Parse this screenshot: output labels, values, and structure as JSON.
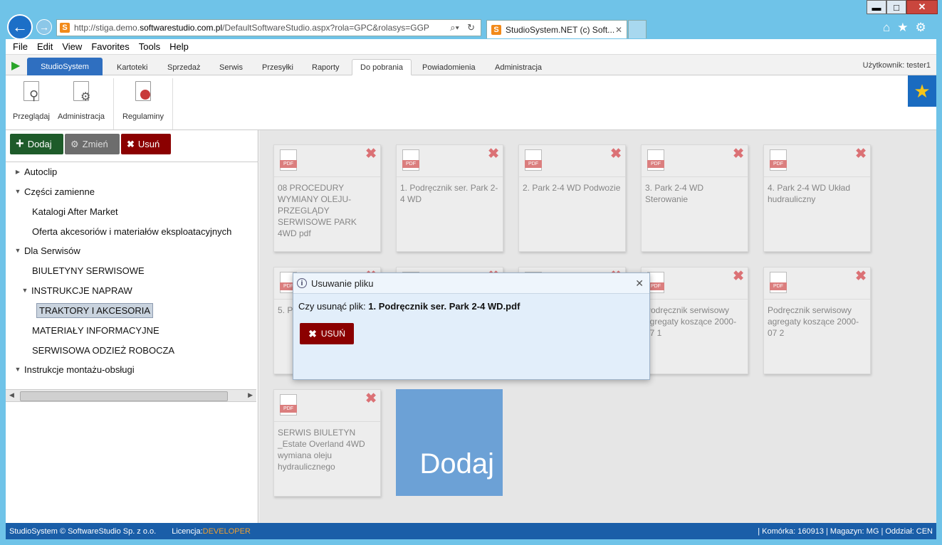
{
  "browser": {
    "url_prefix": "http://stiga.demo.",
    "url_domain": "softwarestudio.com.pl",
    "url_path": "/DefaultSoftwareStudio.aspx?rola=GPC&rolasys=GGP",
    "tab_title": "StudioSystem.NET (c) Soft...",
    "window_minimize": "▬",
    "window_maximize": "□",
    "window_close": "✕",
    "menu": [
      "File",
      "Edit",
      "View",
      "Favorites",
      "Tools",
      "Help"
    ]
  },
  "app": {
    "brand": "StudioSystem",
    "tabs": [
      "Kartoteki",
      "Sprzedaż",
      "Serwis",
      "Przesyłki",
      "Raporty",
      "Do pobrania",
      "Powiadomienia",
      "Administracja"
    ],
    "active_tab": "Do pobrania",
    "user_label": "Użytkownik: tester1",
    "ribbon": [
      "Przeglądaj",
      "Administracja",
      "Regulaminy"
    ]
  },
  "toolbar": {
    "add": "Dodaj",
    "edit": "Zmień",
    "delete": "Usuń"
  },
  "tree": [
    {
      "label": "Autoclip",
      "expand": "▶",
      "level": 0
    },
    {
      "label": "Części zamienne",
      "expand": "▼",
      "level": 0
    },
    {
      "label": "Katalogi After Market",
      "expand": "",
      "level": 1
    },
    {
      "label": "Oferta akcesoriów i materiałów eksploatacyjnych",
      "expand": "",
      "level": 1
    },
    {
      "label": "Dla Serwisów",
      "expand": "▼",
      "level": 0
    },
    {
      "label": "BIULETYNY SERWISOWE",
      "expand": "",
      "level": 1
    },
    {
      "label": "INSTRUKCJE NAPRAW",
      "expand": "▼",
      "level": 1
    },
    {
      "label": "TRAKTORY I AKCESORIA",
      "expand": "",
      "level": 2,
      "selected": true
    },
    {
      "label": "MATERIAŁY INFORMACYJNE",
      "expand": "",
      "level": 1
    },
    {
      "label": "SERWISOWA ODZIEŻ ROBOCZA",
      "expand": "",
      "level": 1
    },
    {
      "label": "Instrukcje montażu-obsługi",
      "expand": "▼",
      "level": 0
    }
  ],
  "files": [
    "08 PROCEDURY WYMIANY OLEJU-PRZEGLĄDY SERWISOWE PARK 4WD pdf",
    "1. Podręcznik ser. Park 2-4 WD",
    "2. Park 2-4 WD Podwozie",
    "3. Park 2-4 WD Sterowanie",
    "4. Park 2-4 WD Układ hudrauliczny",
    "5. P",
    "",
    "",
    "Podręcznik serwisowy agregaty koszące 2000-07 1",
    "Podręcznik serwisowy agregaty koszące 2000-07 2",
    "SERWIS BIULETYN _Estate Overland 4WD wymiana oleju hydraulicznego"
  ],
  "pdf_label": "PDF",
  "add_tile": "Dodaj",
  "dialog": {
    "title": "Usuwanie pliku",
    "question": "Czy usunąć plik: ",
    "filename": "1. Podręcznik ser. Park 2-4 WD.pdf",
    "button": "USUŃ"
  },
  "status": {
    "copyright": "StudioSystem © SoftwareStudio Sp. z o.o.",
    "license_label": "Licencja: ",
    "license_value": "DEVELOPER",
    "right": "| Komórka: 160913 | Magazyn: MG | Oddział: CEN"
  },
  "colors": {
    "accent": "#1e6fc0",
    "danger": "#8b0000",
    "add_green": "#1e5b2a"
  }
}
